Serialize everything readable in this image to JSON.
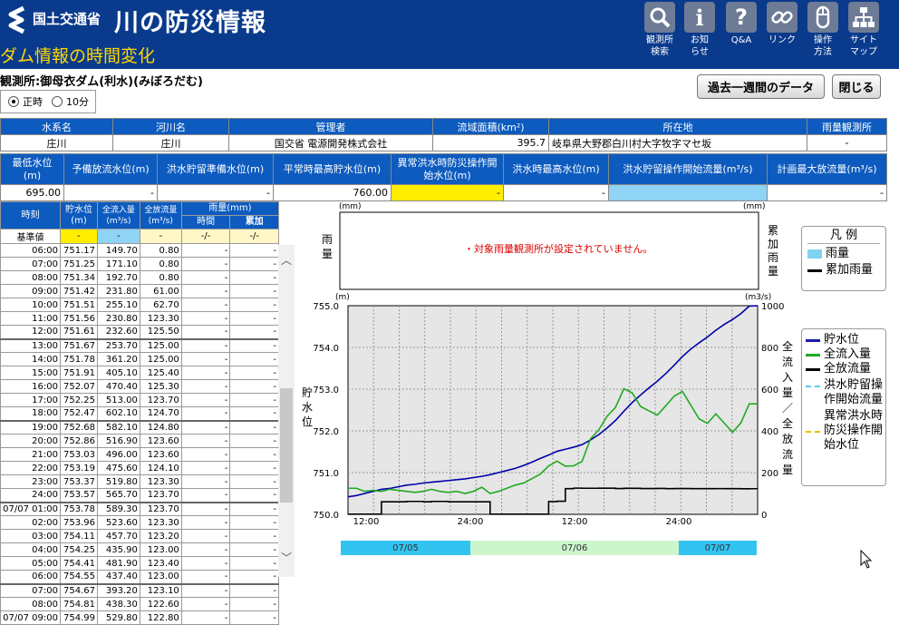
{
  "header": {
    "ministry": "国土交通省",
    "site_title": "川の防災情報",
    "page_title": "ダム情報の時間変化",
    "nav": [
      {
        "label": "観測所\n検索",
        "icon": "magnifier-icon"
      },
      {
        "label": "お知\nらせ",
        "icon": "info-icon"
      },
      {
        "label": "Q&A",
        "icon": "question-icon"
      },
      {
        "label": "リンク",
        "icon": "link-icon"
      },
      {
        "label": "操作\n方法",
        "icon": "mouse-icon"
      },
      {
        "label": "サイト\nマップ",
        "icon": "sitemap-icon"
      }
    ]
  },
  "station": "観測所:御母衣ダム(利水)(みぼろだむ)",
  "time_options": {
    "hourly": "正時",
    "ten_min": "10分",
    "selected": "hourly"
  },
  "buttons": {
    "past_week": "過去一週間のデータ",
    "close": "閉じる"
  },
  "info1": {
    "headers": [
      "水系名",
      "河川名",
      "管理者",
      "流域面積(km²)",
      "所在地",
      "雨量観測所"
    ],
    "values": [
      "庄川",
      "庄川",
      "国交省 電源開発株式会社",
      "395.7",
      "岐阜県大野郡白川村大字牧字マセ坂",
      "-"
    ]
  },
  "info2": {
    "headers": [
      "最低水位(m)",
      "予備放流水位(m)",
      "洪水貯留準備水位(m)",
      "平常時最高貯水位(m)",
      "異常洪水時防災操作開始水位(m)",
      "洪水時最高水位(m)",
      "洪水貯留操作開始流量(m³/s)",
      "計画最大放流量(m³/s)"
    ],
    "values": [
      "695.00",
      "-",
      "-",
      "760.00",
      "-",
      "-",
      "",
      "-"
    ]
  },
  "table": {
    "headers": {
      "time": "時刻",
      "level": "貯水位\n(m)",
      "inflow": "全流入量\n(m³/s)",
      "outflow": "全放流量\n(m³/s)",
      "rain": "雨量(mm)",
      "rain_hour": "時間",
      "rain_cum": "累加"
    },
    "base_label": "基準値",
    "base_values": [
      "-",
      "-",
      "-",
      "-/-",
      "-/-"
    ],
    "rows": [
      [
        "06:00",
        "751.17",
        "149.70",
        "0.80",
        "-",
        "-"
      ],
      [
        "07:00",
        "751.25",
        "171.10",
        "0.80",
        "-",
        "-"
      ],
      [
        "08:00",
        "751.34",
        "192.70",
        "0.80",
        "-",
        "-"
      ],
      [
        "09:00",
        "751.42",
        "231.80",
        "61.00",
        "-",
        "-"
      ],
      [
        "10:00",
        "751.51",
        "255.10",
        "62.70",
        "-",
        "-"
      ],
      [
        "11:00",
        "751.56",
        "230.80",
        "123.30",
        "-",
        "-"
      ],
      [
        "12:00",
        "751.61",
        "232.60",
        "125.50",
        "-",
        "-"
      ],
      [
        "13:00",
        "751.67",
        "253.70",
        "125.00",
        "-",
        "-"
      ],
      [
        "14:00",
        "751.78",
        "361.20",
        "125.00",
        "-",
        "-"
      ],
      [
        "15:00",
        "751.91",
        "405.10",
        "125.40",
        "-",
        "-"
      ],
      [
        "16:00",
        "752.07",
        "470.40",
        "125.30",
        "-",
        "-"
      ],
      [
        "17:00",
        "752.25",
        "513.00",
        "123.70",
        "-",
        "-"
      ],
      [
        "18:00",
        "752.47",
        "602.10",
        "124.70",
        "-",
        "-"
      ],
      [
        "19:00",
        "752.68",
        "582.10",
        "124.80",
        "-",
        "-"
      ],
      [
        "20:00",
        "752.86",
        "516.90",
        "123.60",
        "-",
        "-"
      ],
      [
        "21:00",
        "753.03",
        "496.00",
        "123.60",
        "-",
        "-"
      ],
      [
        "22:00",
        "753.19",
        "475.60",
        "124.10",
        "-",
        "-"
      ],
      [
        "23:00",
        "753.37",
        "519.80",
        "123.30",
        "-",
        "-"
      ],
      [
        "24:00",
        "753.57",
        "565.70",
        "123.70",
        "-",
        "-"
      ],
      [
        "07/07 01:00",
        "753.78",
        "589.30",
        "123.70",
        "-",
        "-"
      ],
      [
        "02:00",
        "753.96",
        "523.60",
        "123.30",
        "-",
        "-"
      ],
      [
        "03:00",
        "754.11",
        "457.70",
        "123.20",
        "-",
        "-"
      ],
      [
        "04:00",
        "754.25",
        "435.90",
        "123.00",
        "-",
        "-"
      ],
      [
        "05:00",
        "754.41",
        "481.90",
        "123.40",
        "-",
        "-"
      ],
      [
        "06:00",
        "754.55",
        "437.40",
        "123.00",
        "-",
        "-"
      ],
      [
        "07:00",
        "754.67",
        "393.20",
        "123.10",
        "-",
        "-"
      ],
      [
        "08:00",
        "754.81",
        "438.30",
        "122.60",
        "-",
        "-"
      ],
      [
        "07/07 09:00",
        "754.99",
        "529.80",
        "122.80",
        "-",
        "-"
      ]
    ]
  },
  "rain_chart": {
    "left_label": "雨量",
    "right_label": "累加雨量",
    "unit_left": "(mm)",
    "unit_right": "(mm)",
    "message": "・対象雨量観測所が設定されていません。",
    "legend_title": "凡 例",
    "legend": [
      {
        "name": "雨量",
        "color": "#7fd3f0"
      },
      {
        "name": "累加雨量",
        "color": "#000000"
      }
    ]
  },
  "chart_data": {
    "type": "line",
    "ylabel": "貯水位",
    "y2label": "全流入量/全放流量",
    "unit_left": "(m)",
    "unit_right": "(m3/s)",
    "ylim": [
      750.0,
      755.0
    ],
    "y2lim": [
      0,
      1000
    ],
    "yticks": [
      "755.0",
      "754.0",
      "753.0",
      "752.0",
      "751.0",
      "750.0"
    ],
    "y2ticks": [
      "1000",
      "800",
      "600",
      "400",
      "200",
      "0"
    ],
    "xticks": [
      "12:00",
      "24:00",
      "12:00",
      "24:00"
    ],
    "dates": [
      "07/05",
      "07/06",
      "07/07"
    ],
    "x": [
      0,
      1,
      2,
      3,
      4,
      5,
      6,
      7,
      8,
      9,
      10,
      11,
      12,
      13,
      14,
      15,
      16,
      17,
      18,
      19,
      20,
      21,
      22,
      23,
      24,
      25,
      26,
      27,
      28,
      29,
      30,
      31,
      32,
      33,
      34,
      35,
      36,
      37,
      38,
      39,
      40,
      41,
      42,
      43,
      44,
      45,
      46,
      47,
      48,
      49
    ],
    "series": [
      {
        "name": "貯水位",
        "color": "#0000aa",
        "axis": "left",
        "values": [
          750.42,
          750.45,
          750.5,
          750.55,
          750.6,
          750.62,
          750.66,
          750.7,
          750.72,
          750.75,
          750.77,
          750.79,
          750.81,
          750.83,
          750.85,
          750.88,
          750.91,
          750.95,
          751.0,
          751.05,
          751.1,
          751.17,
          751.25,
          751.34,
          751.42,
          751.51,
          751.56,
          751.61,
          751.67,
          751.78,
          751.91,
          752.07,
          752.25,
          752.47,
          752.68,
          752.86,
          753.03,
          753.19,
          753.37,
          753.57,
          753.78,
          753.96,
          754.11,
          754.25,
          754.41,
          754.55,
          754.67,
          754.81,
          754.99,
          755.0
        ]
      },
      {
        "name": "全流入量",
        "color": "#22aa22",
        "axis": "right",
        "values": [
          125,
          125,
          110,
          115,
          110,
          120,
          115,
          110,
          105,
          110,
          120,
          110,
          105,
          110,
          100,
          110,
          130,
          100,
          110,
          125,
          140,
          149.7,
          171.1,
          192.7,
          231.8,
          255.1,
          230.8,
          232.6,
          253.7,
          361.2,
          405.1,
          470.4,
          513,
          602.1,
          582.1,
          516.9,
          496,
          475.6,
          519.8,
          565.7,
          589.3,
          523.6,
          457.7,
          435.9,
          481.9,
          437.4,
          393.2,
          438.3,
          529.8,
          529.8
        ]
      },
      {
        "name": "全放流量",
        "color": "#000000",
        "axis": "right",
        "values": [
          0.8,
          0.8,
          0.8,
          0.8,
          60,
          60,
          60,
          62,
          62,
          60,
          62,
          62,
          60,
          60,
          60,
          60,
          60,
          0.8,
          0.8,
          0.8,
          0.8,
          0.8,
          0.8,
          0.8,
          61,
          62.7,
          123.3,
          125.5,
          125,
          125,
          125.4,
          125.3,
          123.7,
          124.7,
          124.8,
          123.6,
          123.6,
          124.1,
          123.3,
          123.7,
          123.7,
          123.3,
          123.2,
          123,
          123.4,
          123,
          123.1,
          122.6,
          122.8,
          122.8
        ]
      }
    ],
    "legend": [
      {
        "name": "貯水位",
        "color": "#1a1aa6"
      },
      {
        "name": "全流入量",
        "color": "#22aa22"
      },
      {
        "name": "全放流量",
        "color": "#000000"
      },
      {
        "name": "洪水貯留操作開始流量",
        "color": "#5ec8f0"
      },
      {
        "name": "異常洪水時防災操作開始水位",
        "color": "#e6c000"
      }
    ]
  }
}
